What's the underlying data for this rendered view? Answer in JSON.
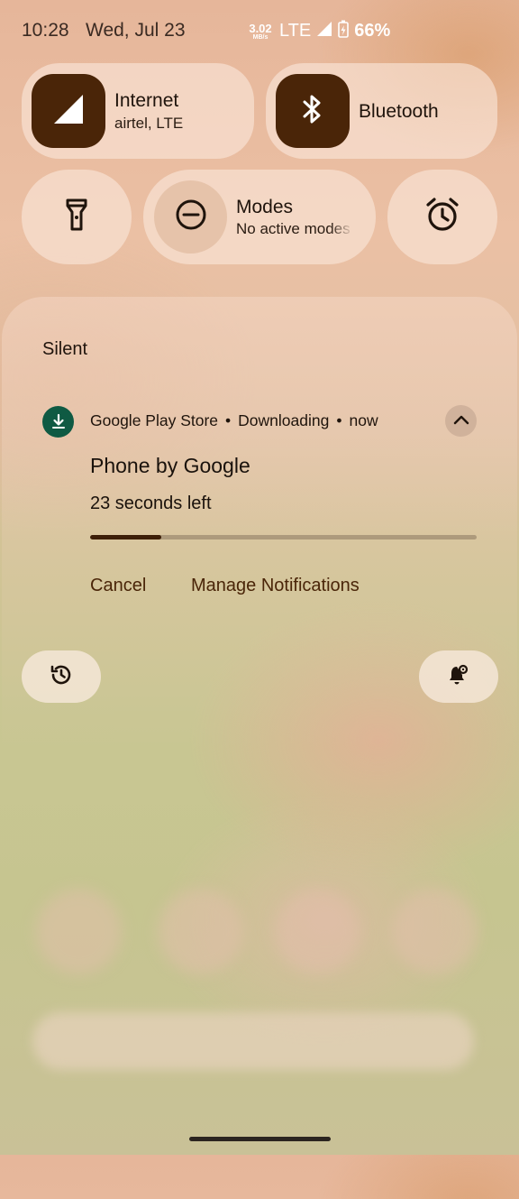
{
  "status_bar": {
    "time": "10:28",
    "date": "Wed, Jul 23",
    "net_speed_value": "3.02",
    "net_speed_unit": "MB/s",
    "network_type": "LTE",
    "battery_percent": "66%"
  },
  "quick_settings": {
    "internet": {
      "title": "Internet",
      "subtitle": "airtel, LTE",
      "icon": "signal-icon"
    },
    "bluetooth": {
      "title": "Bluetooth",
      "icon": "bluetooth-icon"
    },
    "flashlight": {
      "icon": "flashlight-icon"
    },
    "modes": {
      "title": "Modes",
      "subtitle": "No active modes",
      "icon": "do-not-disturb-icon"
    },
    "alarm": {
      "icon": "alarm-icon"
    }
  },
  "notifications": {
    "section_label": "Silent",
    "items": [
      {
        "app_name": "Google Play Store",
        "status": "Downloading",
        "time": "now",
        "title": "Phone by Google",
        "subtitle": "23 seconds left",
        "progress": 0.185,
        "actions": [
          "Cancel",
          "Manage Notifications"
        ]
      }
    ]
  },
  "bottom_buttons": {
    "history_icon": "history-icon",
    "notification_settings_icon": "notification-settings-icon"
  },
  "colors": {
    "accent_dark": "#4a2508",
    "app_icon_bg": "#0f5a43"
  }
}
